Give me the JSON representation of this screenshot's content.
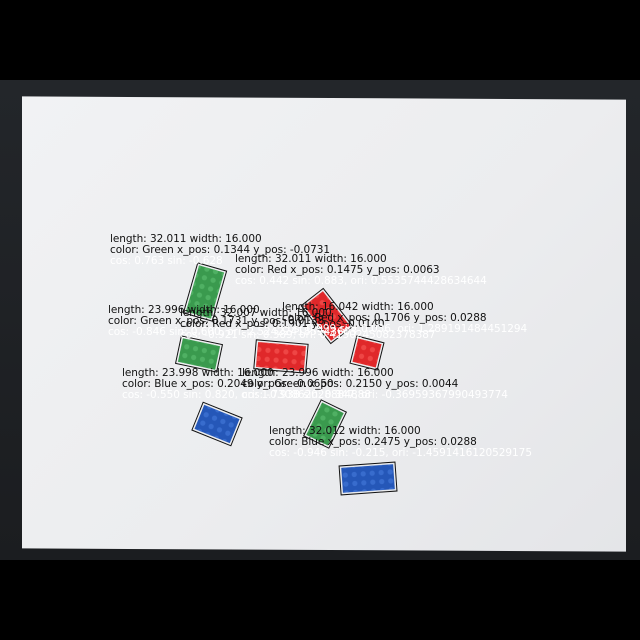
{
  "annotations": [
    {
      "length": "length: 32.011 width: 16.000",
      "color": "color: Green x_pos: 0.1344 y_pos: -0.0731",
      "cos": "cos: 0.763 sin: -0.628"
    },
    {
      "length": "length: 32.011 width: 16.000",
      "color": "color: Red x_pos: 0.1475 y_pos: 0.0063",
      "cos": "cos: 0.442 sin: 0.883, ori: 0.5535744428634644"
    },
    {
      "length": "length: 23.996 width: 16.000",
      "color": "color: Green x_pos: 0.1731 y_pos: 0.0138",
      "cos": "cos: -0.846 sin: 0.600, ori: 2.524224185943603"
    },
    {
      "length": "length: 32.007 width: 16.000",
      "color": "color: Red x_pos: 0.1901 y_pos: 0.0140",
      "cos": "cos: -0.921 sin: 0.389, ori: 0.4150245082378387"
    },
    {
      "length": "length: 16.042 width: 16.000",
      "color": "color: Red x_pos: 0.1706 y_pos: 0.0288",
      "cos": "cos: 0.999 sin: 0.036, ori: 1.289191484451294"
    },
    {
      "length": "length: 23.998 width: 16.000",
      "color": "color: Blue x_pos: 0.2049 y_pos: -0.0650",
      "cos": "cos: -0.550 sin: 0.820, ori: 1.730862028884888"
    },
    {
      "length": "length: 23.996 width: 16.000",
      "color": "color: Green x_pos: 0.2150 y_pos: 0.0044",
      "cos": "cos: -0.938 sin: 0.347, ori: -0.36959367990493774"
    },
    {
      "length": "length: 32.012 width: 16.000",
      "color": "color: Blue x_pos: 0.2475 y_pos: 0.0288",
      "cos": "cos: -0.946 sin: -0.215, ori: -1.4591416120529175"
    }
  ],
  "colors": {
    "green": "#3a9a4e",
    "red": "#e0282a",
    "blue": "#2557b8"
  }
}
